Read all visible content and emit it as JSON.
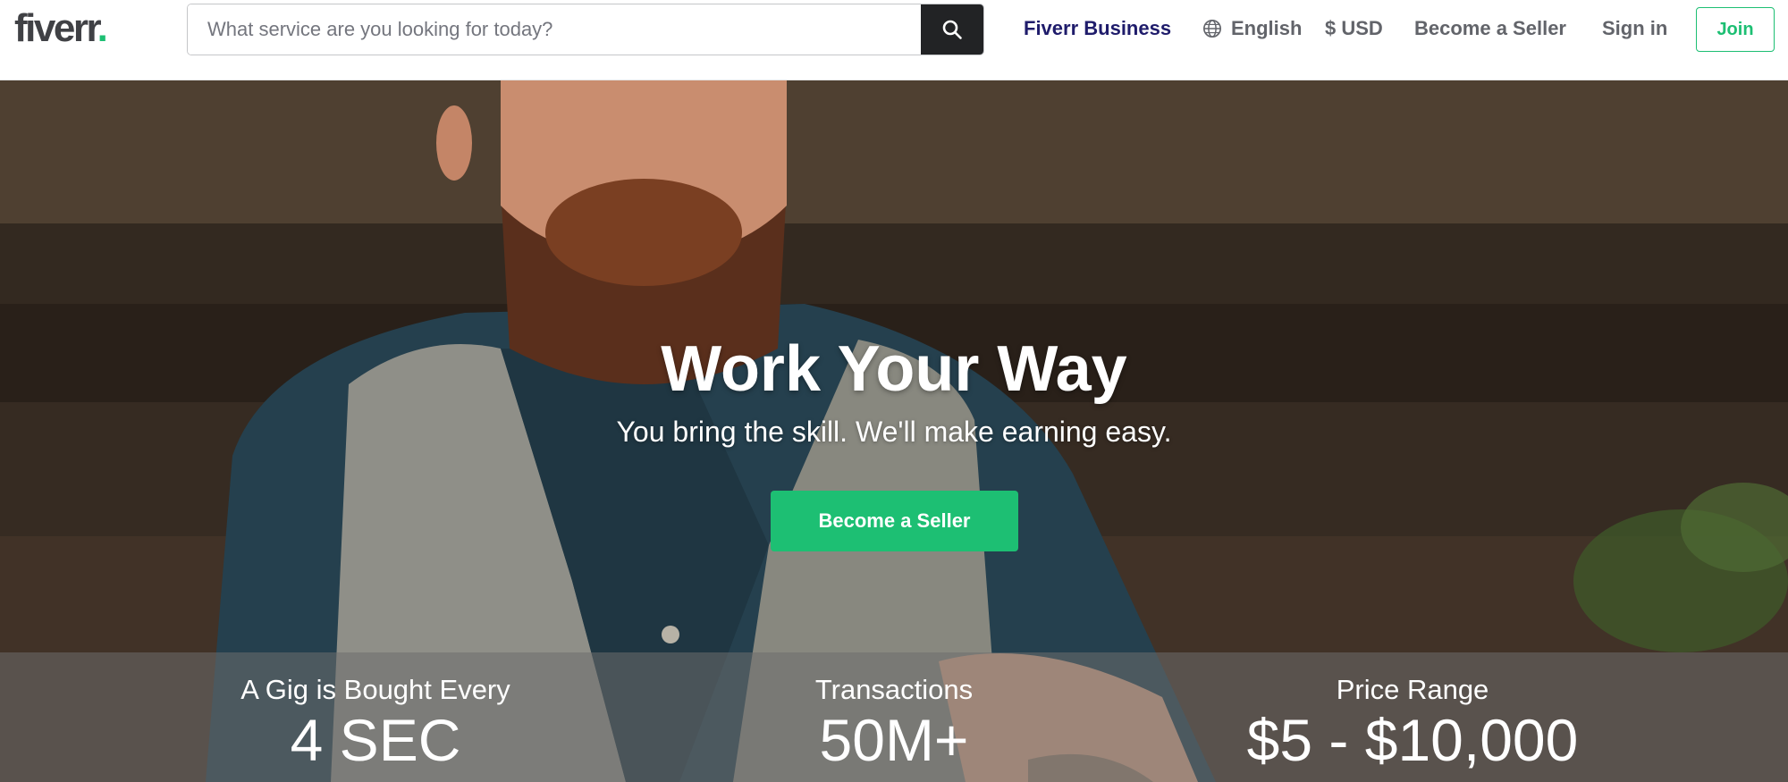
{
  "header": {
    "logo_text": "fiverr",
    "logo_dot": ".",
    "search": {
      "placeholder": "What service are you looking for today?",
      "value": "",
      "button_icon": "search-icon"
    },
    "nav": {
      "business": "Fiverr Business",
      "language": "English",
      "language_icon": "globe-icon",
      "currency": "$ USD",
      "become_seller": "Become a Seller",
      "sign_in": "Sign in",
      "join": "Join"
    }
  },
  "hero": {
    "title": "Work Your Way",
    "subtitle": "You bring the skill. We'll make earning easy.",
    "cta": "Become a Seller"
  },
  "stats": [
    {
      "label": "A Gig is Bought Every",
      "value": "4 SEC"
    },
    {
      "label": "Transactions",
      "value": "50M+"
    },
    {
      "label": "Price Range",
      "value": "$5 - $10,000"
    }
  ],
  "colors": {
    "brand_green": "#1dbf73",
    "business_navy": "#1f1c6b",
    "text_gray": "#62646a",
    "search_button": "#222325"
  }
}
